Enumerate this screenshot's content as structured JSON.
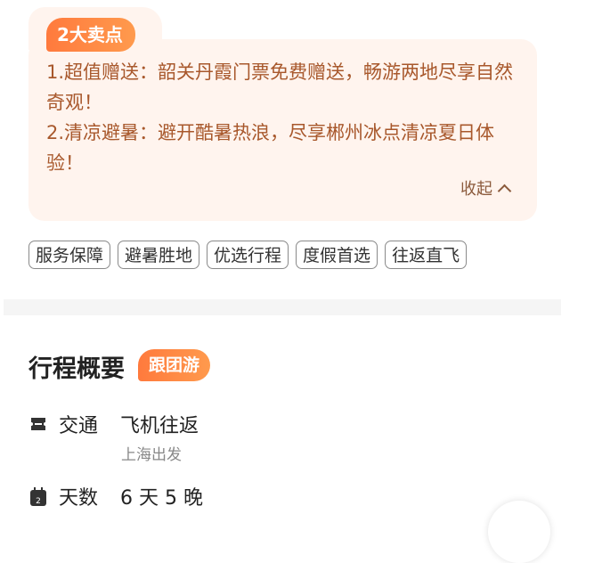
{
  "selling_points": {
    "badge": "2大卖点",
    "items": [
      "1.超值赠送：韶关丹霞门票免费赠送，畅游两地尽享自然奇观！",
      "2.清凉避暑：避开酷暑热浪，尽享郴州冰点清凉夏日体验！"
    ],
    "collapse_label": "收起"
  },
  "tags": [
    "服务保障",
    "避暑胜地",
    "优选行程",
    "度假首选",
    "往返直飞"
  ],
  "overview": {
    "title": "行程概要",
    "badge": "跟团游",
    "transport": {
      "label": "交通",
      "value": "飞机往返",
      "sub": "上海出发"
    },
    "days": {
      "label": "天数",
      "value": "6 天 5 晚",
      "icon_number": "2"
    }
  },
  "colors": {
    "accent": "#ff7a3d",
    "card_bg": "#fff4ee",
    "card_text": "#a8582c"
  }
}
